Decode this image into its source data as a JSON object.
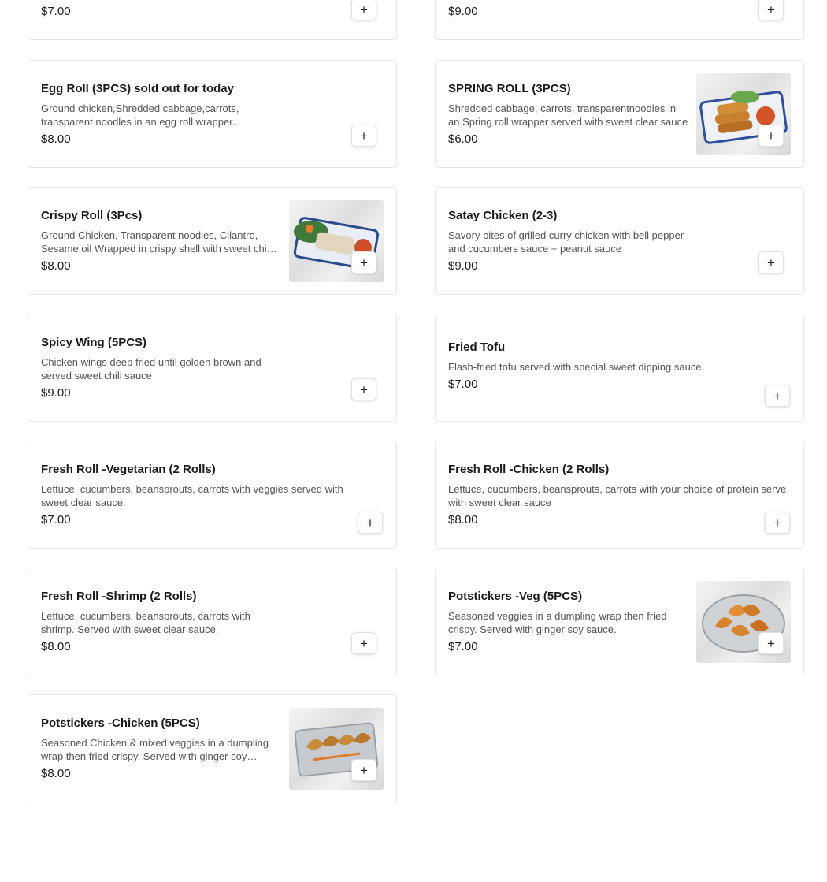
{
  "ui": {
    "add_icon_glyph": "+"
  },
  "items": {
    "top_left": {
      "name": "",
      "desc": "",
      "price": "$7.00"
    },
    "top_right": {
      "name": "",
      "desc": "",
      "price": "$9.00"
    },
    "egg_roll": {
      "name": "Egg Roll (3PCS) sold out for today",
      "desc": "Ground chicken,Shredded cabbage,carrots, transparent noodles in an egg roll wrapper...",
      "price": "$8.00"
    },
    "spring_roll": {
      "name": "SPRING ROLL (3PCS)",
      "desc": "Shredded cabbage, carrots, transparentnoodles in an Spring roll wrapper served with sweet clear sauce",
      "price": "$6.00"
    },
    "crispy_roll": {
      "name": "Crispy Roll (3Pcs)",
      "desc": "Ground Chicken, Transparent noodles, Cilantro, Sesame oil Wrapped in crispy shell with sweet chili sauce",
      "price": "$8.00"
    },
    "satay_chicken": {
      "name": "Satay Chicken (2-3)",
      "desc": "Savory bites of grilled curry chicken with bell pepper and cucumbers sauce + peanut sauce",
      "price": "$9.00"
    },
    "spicy_wing": {
      "name": "Spicy Wing (5PCS)",
      "desc": "Chicken wings deep fried until golden brown and served sweet chili sauce",
      "price": "$9.00"
    },
    "fried_tofu": {
      "name": "Fried Tofu",
      "desc": "Flash-fried tofu served with special sweet dipping sauce",
      "price": "$7.00"
    },
    "fresh_roll_veg": {
      "name": "Fresh Roll -Vegetarian (2 Rolls)",
      "desc": "Lettuce, cucumbers, beansprouts, carrots with veggies served with sweet clear sauce.",
      "price": "$7.00"
    },
    "fresh_roll_chicken": {
      "name": "Fresh Roll -Chicken (2 Rolls)",
      "desc": "Lettuce, cucumbers, beansprouts, carrots with your choice of protein serve with sweet clear sauce",
      "price": "$8.00"
    },
    "fresh_roll_shrimp": {
      "name": "Fresh Roll -Shrimp (2 Rolls)",
      "desc": "Lettuce, cucumbers, beansprouts, carrots with shrimp. Served with sweet clear sauce.",
      "price": "$8.00"
    },
    "potstickers_veg": {
      "name": "Potstickers -Veg (5PCS)",
      "desc": "Seasoned veggies in a dumpling wrap then fried crispy. Served with ginger soy sauce.",
      "price": "$7.00"
    },
    "potstickers_chicken": {
      "name": "Potstickers -Chicken (5PCS)",
      "desc": "Seasoned Chicken & mixed veggies in a dumpling wrap then fried crispy, Served with ginger soy sauce.",
      "price": "$8.00"
    }
  }
}
